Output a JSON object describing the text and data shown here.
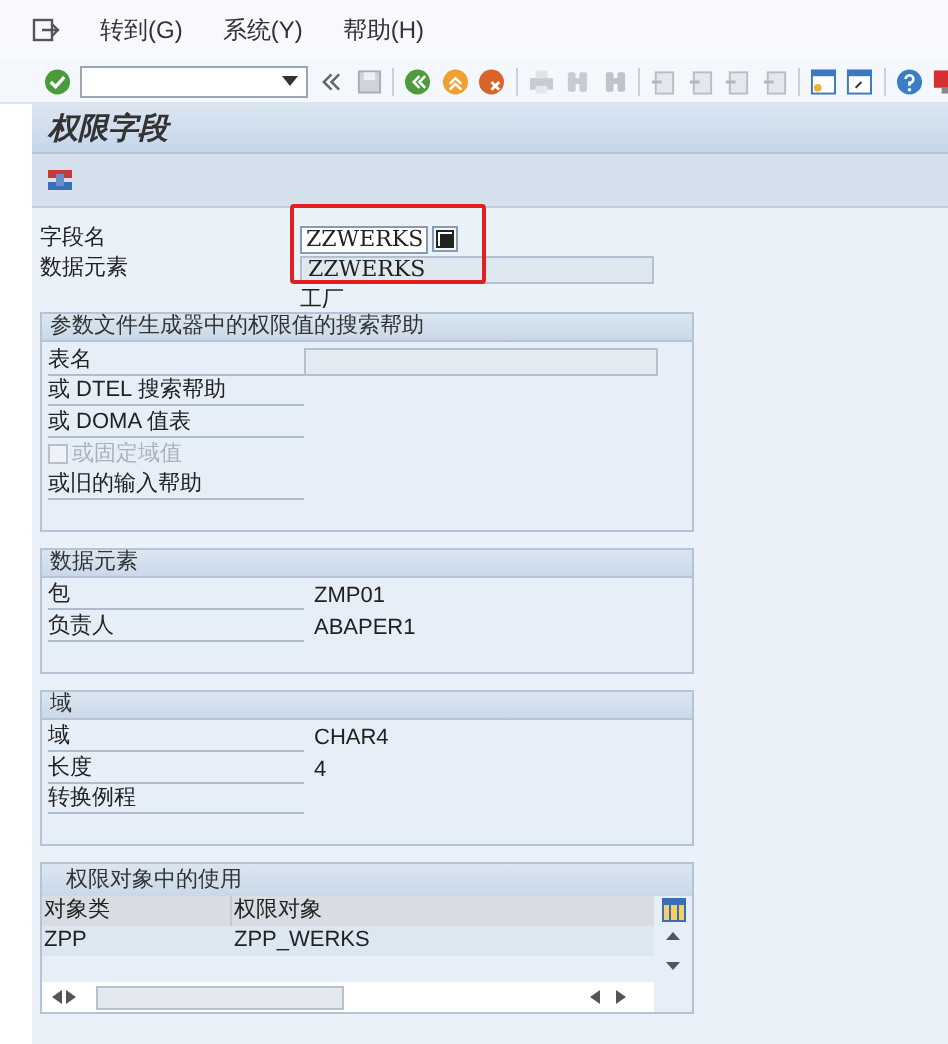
{
  "menu": [
    {
      "label": "转到(G)"
    },
    {
      "label": "系统(Y)"
    },
    {
      "label": "帮助(H)"
    }
  ],
  "title": "权限字段",
  "fields": [
    {
      "label": "字段名",
      "value": "ZZWERKS",
      "kind": "input"
    },
    {
      "label": "数据元素",
      "value": "ZZWERKS",
      "kind": "display"
    }
  ],
  "description": "工厂",
  "groups": [
    {
      "title": "参数文件生成器中的权限值的搜索帮助",
      "rows": [
        {
          "kind": "field",
          "label": "表名"
        },
        {
          "kind": "text",
          "label": "或 DTEL 搜索帮助"
        },
        {
          "kind": "text",
          "label": "或 DOMA 值表"
        },
        {
          "kind": "checkbox",
          "label": "或固定域值",
          "checked": false,
          "disabled": true
        },
        {
          "kind": "text",
          "label": "或旧的输入帮助"
        }
      ]
    },
    {
      "title": "数据元素",
      "rows": [
        {
          "kind": "text",
          "label": "包",
          "value": "ZMP01"
        },
        {
          "kind": "text",
          "label": "负责人",
          "value": "ABAPER1"
        }
      ]
    },
    {
      "title": "域",
      "rows": [
        {
          "kind": "text",
          "label": "域",
          "value": "CHAR4"
        },
        {
          "kind": "text",
          "label": "长度",
          "value": "4"
        },
        {
          "kind": "text",
          "label": "转换例程"
        }
      ]
    }
  ],
  "table": {
    "title": "权限对象中的使用",
    "columns": [
      "对象类",
      "权限对象"
    ],
    "rows": [
      [
        "ZPP",
        "ZPP_WERKS"
      ]
    ]
  }
}
